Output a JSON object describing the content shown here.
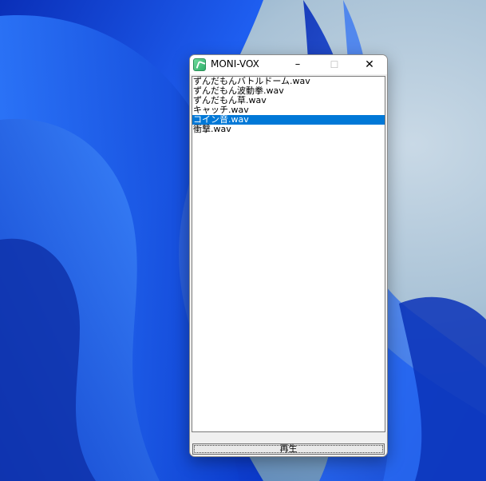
{
  "window": {
    "title": "MONI-VOX",
    "controls": {
      "minimize": "–",
      "maximize": "☐",
      "close": "✕"
    }
  },
  "file_list": {
    "items": [
      "ずんだもんバトルドーム.wav",
      "ずんだもん波動拳.wav",
      "ずんだもん草.wav",
      "キャッチ.wav",
      "コイン音.wav",
      "衝撃.wav"
    ],
    "selected_index": 4
  },
  "play_button": {
    "label": "再生"
  },
  "colors": {
    "selection": "#0078d7",
    "desktop_blue": "#1a4fd6"
  }
}
